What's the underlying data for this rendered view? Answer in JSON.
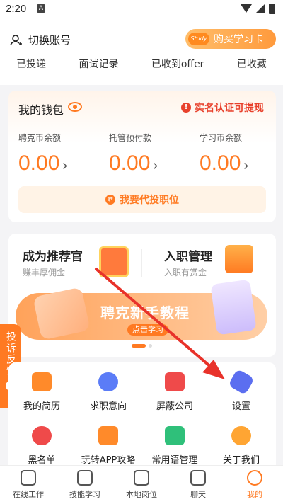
{
  "status_bar": {
    "time": "2:20",
    "notif_letter": "A"
  },
  "header": {
    "switch_account": "切换账号",
    "study_badge": "Study",
    "buy_card": "购买学习卡",
    "records": [
      "已投递",
      "面试记录",
      "已收到offer",
      "已收藏"
    ]
  },
  "wallet": {
    "title": "我的钱包",
    "verify_text": "实名认证可提现",
    "balances": [
      {
        "label": "聘克币余额",
        "value": "0.00"
      },
      {
        "label": "托管预付款",
        "value": "0.00"
      },
      {
        "label": "学习币余额",
        "value": "0.00"
      }
    ],
    "agent_button": "我要代投职位"
  },
  "promo": {
    "recommender_title": "成为推荐官",
    "recommender_sub": "赚丰厚佣金",
    "entry_title": "入职管理",
    "entry_sub": "入职有赏金",
    "banner_text": "聘克新手教程",
    "banner_button": "点击学习"
  },
  "complaint": {
    "label": "投诉反馈"
  },
  "grid": {
    "items": [
      {
        "label": "我的简历",
        "color": "#ff8a2a"
      },
      {
        "label": "求职意向",
        "color": "#5b7cf7"
      },
      {
        "label": "屏蔽公司",
        "color": "#ef4a4a"
      },
      {
        "label": "设置",
        "color": "#5b6ef0"
      },
      {
        "label": "黑名单",
        "color": "#ef4a4a"
      },
      {
        "label": "玩转APP攻略",
        "color": "#ff8a2a"
      },
      {
        "label": "常用语管理",
        "color": "#2fc07a"
      },
      {
        "label": "关于我们",
        "color": "#ffa533"
      }
    ]
  },
  "nav": {
    "items": [
      {
        "label": "在线工作"
      },
      {
        "label": "技能学习"
      },
      {
        "label": "本地岗位"
      },
      {
        "label": "聊天"
      },
      {
        "label": "我的"
      }
    ]
  },
  "colors": {
    "accent": "#ff7a22",
    "warning": "#e8412c",
    "annotation_arrow": "#e8322a"
  }
}
